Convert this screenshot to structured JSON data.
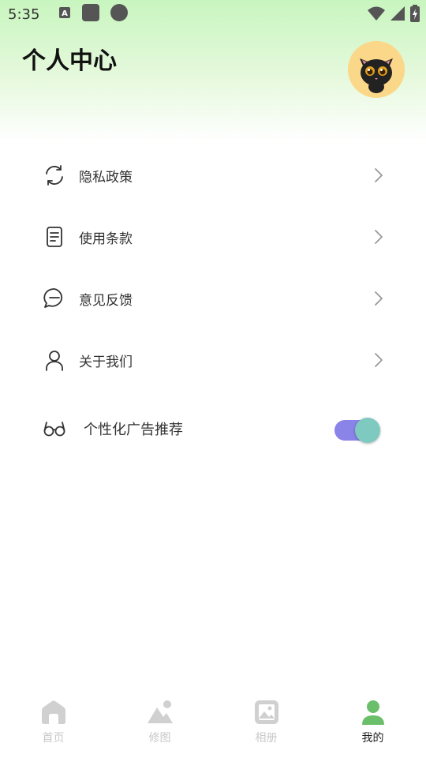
{
  "status_bar": {
    "time": "5:35"
  },
  "header": {
    "title": "个人中心"
  },
  "menu": {
    "items": [
      {
        "label": "隐私政策",
        "icon": "sync-icon"
      },
      {
        "label": "使用条款",
        "icon": "document-icon"
      },
      {
        "label": "意见反馈",
        "icon": "chat-bubble-icon"
      },
      {
        "label": "关于我们",
        "icon": "person-icon"
      }
    ],
    "toggle": {
      "label": "个性化广告推荐",
      "icon": "glasses-icon",
      "enabled": true
    }
  },
  "bottom_nav": {
    "items": [
      {
        "label": "首页",
        "icon": "home-icon",
        "active": false
      },
      {
        "label": "修图",
        "icon": "mountain-icon",
        "active": false
      },
      {
        "label": "相册",
        "icon": "image-icon",
        "active": false
      },
      {
        "label": "我的",
        "icon": "user-icon",
        "active": true
      }
    ]
  },
  "colors": {
    "header_gradient_top": "#c8f5bf",
    "toggle_track": "#8a83e8",
    "toggle_knob": "#7fcac0",
    "nav_inactive": "#d0d0d0",
    "nav_active_icon": "#6cbf6a"
  }
}
